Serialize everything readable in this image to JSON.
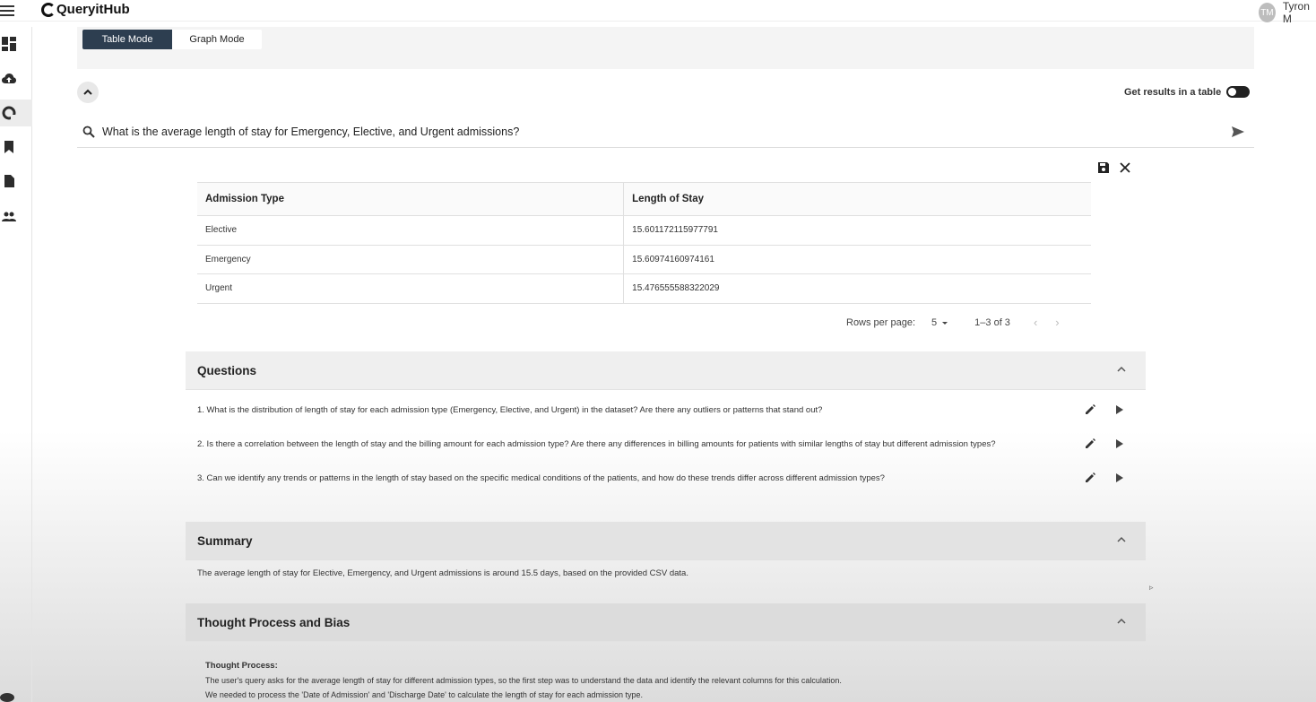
{
  "app": {
    "name": "QueryitHub",
    "user_initials": "TM",
    "user_name": "Tyron M"
  },
  "sidebar": {
    "items": [
      {
        "icon": "dashboard-icon"
      },
      {
        "icon": "cloud-upload-icon"
      },
      {
        "icon": "query-icon",
        "active": true
      },
      {
        "icon": "bookmark-icon"
      },
      {
        "icon": "document-icon"
      },
      {
        "icon": "people-icon"
      }
    ]
  },
  "modes": {
    "table": "Table Mode",
    "graph": "Graph Mode",
    "active": "table"
  },
  "toggle": {
    "label": "Get results in a table",
    "on": true
  },
  "search": {
    "query": "What is the average length of stay for Emergency, Elective, and Urgent admissions?"
  },
  "table": {
    "columns": [
      "Admission Type",
      "Length of Stay"
    ],
    "rows": [
      [
        "Elective",
        "15.601172115977791"
      ],
      [
        "Emergency",
        "15.60974160974161"
      ],
      [
        "Urgent",
        "15.476555588322029"
      ]
    ],
    "pagination": {
      "rows_label": "Rows per page:",
      "rows_value": "5",
      "range": "1–3 of 3"
    }
  },
  "questions": {
    "title": "Questions",
    "items": [
      "1. What is the distribution of length of stay for each admission type (Emergency, Elective, and Urgent) in the dataset? Are there any outliers or patterns that stand out?",
      "2. Is there a correlation between the length of stay and the billing amount for each admission type? Are there any differences in billing amounts for patients with similar lengths of stay but different admission types?",
      "3. Can we identify any trends or patterns in the length of stay based on the specific medical conditions of the patients, and how do these trends differ across different admission types?"
    ]
  },
  "summary": {
    "title": "Summary",
    "text": "The average length of stay for Elective, Emergency, and Urgent admissions is around 15.5 days, based on the provided CSV data."
  },
  "thought": {
    "title": "Thought Process and Bias",
    "heading": "Thought Process:",
    "lines": [
      "The user's query asks for the average length of stay for different admission types, so the first step was to understand the data and identify the relevant columns for this calculation.",
      "We needed to process the 'Date of Admission' and 'Discharge Date' to calculate the length of stay for each admission type."
    ]
  }
}
